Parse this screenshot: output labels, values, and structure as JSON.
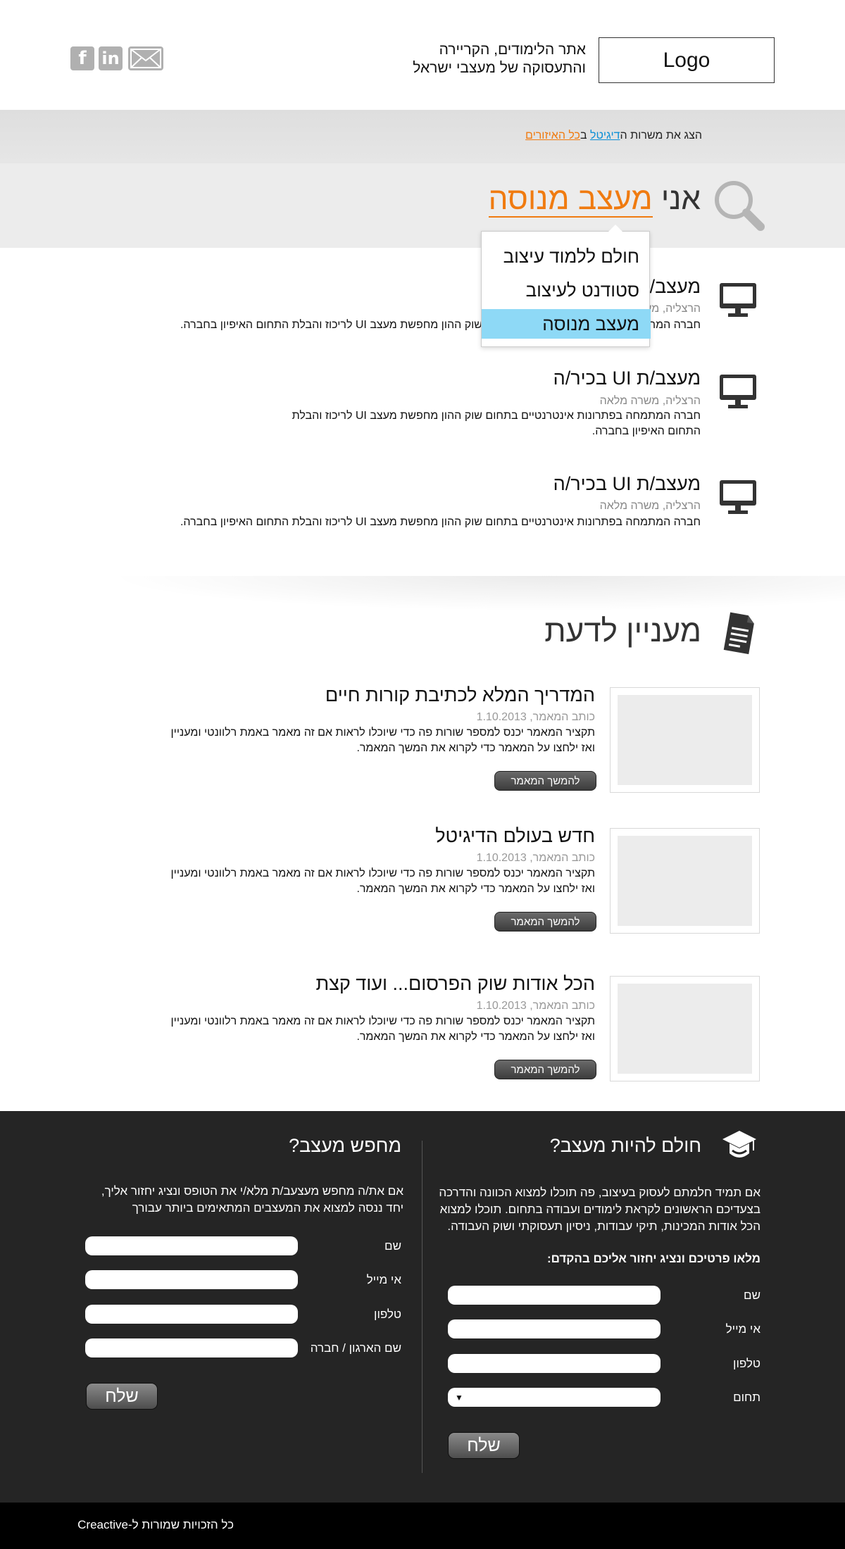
{
  "header": {
    "logo": "Logo",
    "tagline_line1": "אתר הלימודים, הקריירה",
    "tagline_line2": "והתעסוקה של מעצבי ישראל",
    "social": [
      {
        "icon": "mail-icon"
      },
      {
        "icon": "linkedin-icon",
        "text": "in"
      },
      {
        "icon": "facebook-icon",
        "text": "f"
      }
    ]
  },
  "filter": {
    "prefix": "הצג את משרות ה",
    "field": "דיגיטל",
    "middle": " ב",
    "region": "כל האיזורים"
  },
  "hero": {
    "prefix": "אני ",
    "role": "מעצב מנוסה",
    "icon": "magnifier-icon"
  },
  "dropdown": {
    "options": [
      "חולם ללמוד עיצוב",
      "סטודנט לעיצוב",
      "מעצב מנוסה"
    ],
    "selected_index": 2
  },
  "jobs": [
    {
      "title": "מעצב/ת UI בכיר/ה",
      "meta": "הרצליה, משרה מלאה",
      "desc": "חברה המתמחה בפתרונות אינטרנטיים בתחום שוק ההון מחפשת מעצב UI לריכוז והבלת התחום האיפיון בחברה.",
      "icon": "monitor-icon"
    },
    {
      "title": "מעצב/ת UI בכיר/ה",
      "meta": "הרצליה, משרה מלאה",
      "desc": "חברה המתמחה בפתרונות אינטרנטיים בתחום שוק ההון מחפשת מעצב UI לריכוז והבלת התחום האיפיון בחברה.",
      "icon": "monitor-icon"
    },
    {
      "title": "מעצב/ת UI בכיר/ה",
      "meta": "הרצליה, משרה מלאה",
      "desc": "חברה המתמחה בפתרונות אינטרנטיים בתחום שוק ההון מחפשת מעצב UI לריכוז והבלת התחום האיפיון בחברה.",
      "icon": "monitor-icon"
    }
  ],
  "interest": {
    "title": "מעניין לדעת",
    "icon": "document-icon",
    "articles": [
      {
        "title": "המדריך המלא לכתיבת קורות חיים",
        "meta": "כותב המאמר, 1.10.2013",
        "desc_line1": "תקציר המאמר יכנס למספר שורות פה כדי שיוכלו לראות אם זה מאמר באמת רלוונטי ומעניין",
        "desc_line2": "ואז ילחצו על המאמר כדי לקרוא את המשך המאמר.",
        "button": "להמשך המאמר"
      },
      {
        "title": "חדש בעולם הדיגיטל",
        "meta": "כותב המאמר, 1.10.2013",
        "desc_line1": "תקציר המאמר יכנס למספר שורות פה כדי שיוכלו לראות אם זה מאמר באמת רלוונטי ומעניין",
        "desc_line2": "ואז ילחצו על המאמר כדי לקרוא את המשך המאמר.",
        "button": "להמשך המאמר"
      },
      {
        "title": "הכל אודות שוק הפרסום... ועוד קצת",
        "meta": "כותב המאמר, 1.10.2013",
        "desc_line1": "תקציר המאמר יכנס למספר שורות פה כדי שיוכלו לראות אם זה מאמר באמת רלוונטי ומעניין",
        "desc_line2": "ואז ילחצו על המאמר כדי לקרוא את המשך המאמר.",
        "button": "להמשך המאמר"
      }
    ]
  },
  "dream_form": {
    "title": "חולם להיות מעצב?",
    "icon": "graduation-cap-icon",
    "text_line1": "אם תמיד חלמתם לעסוק בעיצוב, פה תוכלו למצוא הכוונה והדרכה",
    "text_line2": "בצעדיכם הראשונים לקראת לימודים ועבודה בתחום. תוכלו למצוא",
    "text_line3": "הכל אודות המכינות, תיקי עבודות, ניסיון תעסוקתי ושוק העבודה.",
    "cta": "מלאו פרטיכם ונציג יחזור אליכם בהקדם:",
    "labels": [
      "שם",
      "אי מייל",
      "טלפון",
      "תחום"
    ],
    "select_value": "",
    "button": "שלח"
  },
  "seek_form": {
    "title": "מחפש מעצב?",
    "text_line1": "אם את/ה מחפש מעצעב/ת מלא/י את הטופס ונציג יחזור אליך,",
    "text_line2": "יחד ננסה למצוא את המעצבים המתאימים ביותר עבורך",
    "labels": [
      "שם",
      "אי מייל",
      "טלפון",
      "שם הארגון / חברה"
    ],
    "button": "שלח"
  },
  "footer": {
    "copyright": "כל הזכויות שמורות ל-Creactive"
  }
}
